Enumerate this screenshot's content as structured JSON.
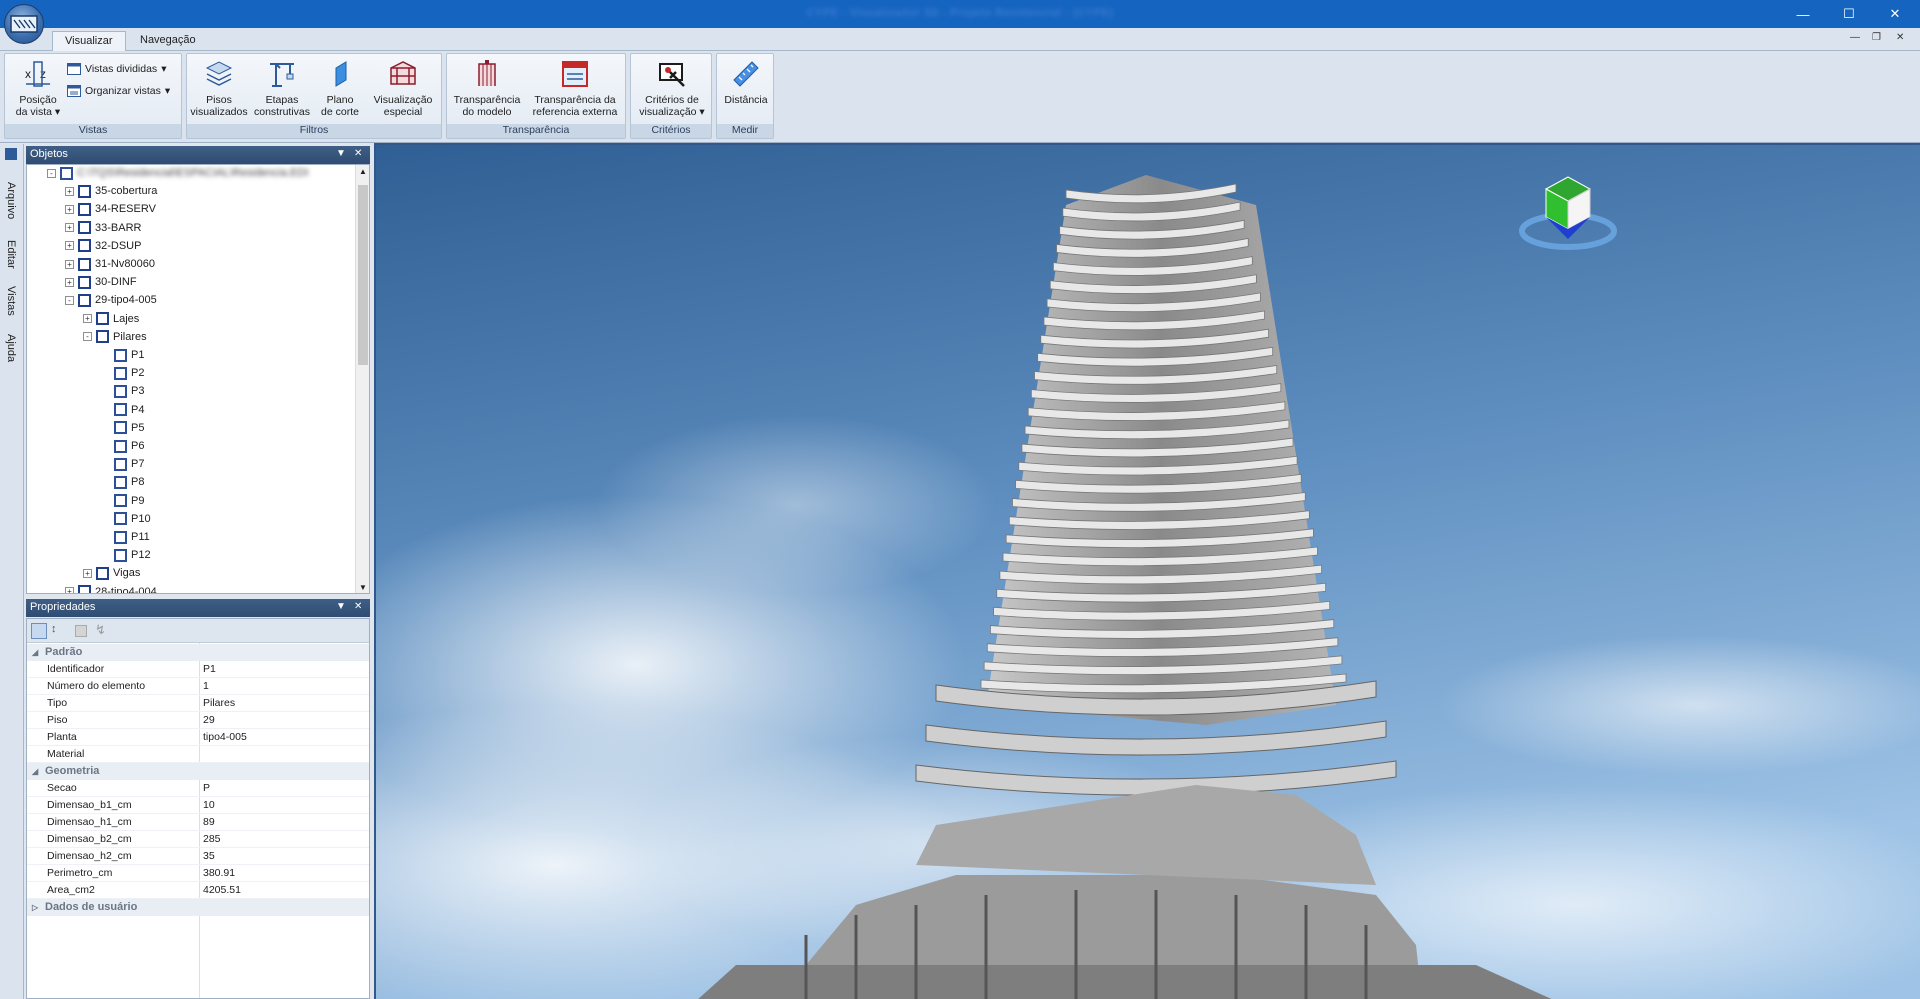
{
  "window": {
    "title": "CYPE - Visualizador 3D - Projeto Residencial - (CYPE)"
  },
  "ribbon_tabs": [
    "Visualizar",
    "Navegação"
  ],
  "groups": {
    "vistas": {
      "caption": "Vistas",
      "posicao_label_1": "Posição",
      "posicao_label_2": "da vista",
      "vistas_divididas": "Vistas divididas",
      "organizar_vistas": "Organizar vistas"
    },
    "filtros": {
      "caption": "Filtros",
      "pisos_1": "Pisos",
      "pisos_2": "visualizados",
      "etapas_1": "Etapas",
      "etapas_2": "construtivas",
      "plano_1": "Plano",
      "plano_2": "de corte",
      "visual_1": "Visualização",
      "visual_2": "especial"
    },
    "transparencia": {
      "caption": "Transparência",
      "modelo_1": "Transparência",
      "modelo_2": "do modelo",
      "ref_1": "Transparência da",
      "ref_2": "referencia externa"
    },
    "criterios": {
      "caption": "Critérios",
      "label_1": "Critérios de",
      "label_2": "visualização"
    },
    "medir": {
      "caption": "Medir",
      "label": "Distância"
    }
  },
  "side_tabs": [
    "Arquivo",
    "Editar",
    "Vistas",
    "Ajuda"
  ],
  "objects_panel": {
    "title": "Objetos",
    "root": "C:\\TQS\\Residencial\\ESPACIAL\\Residencia.EDI",
    "floors": [
      "35-cobertura",
      "34-RESERV",
      "33-BARR",
      "32-DSUP",
      "31-Nv80060",
      "30-DINF",
      "29-tipo4-005"
    ],
    "sub": [
      "Lajes",
      "Pilares"
    ],
    "pilares": [
      "P1",
      "P2",
      "P3",
      "P4",
      "P5",
      "P6",
      "P7",
      "P8",
      "P9",
      "P10",
      "P11",
      "P12"
    ],
    "vigas": "Vigas",
    "next_floor": "28-tipo4-004"
  },
  "properties_panel": {
    "title": "Propriedades",
    "cat_padrao": "Padrão",
    "padrao": [
      [
        "Identificador",
        "P1"
      ],
      [
        "Número do elemento",
        "1"
      ],
      [
        "Tipo",
        "Pilares"
      ],
      [
        "Piso",
        "29"
      ],
      [
        "Planta",
        "tipo4-005"
      ],
      [
        "Material",
        ""
      ]
    ],
    "cat_geometria": "Geometria",
    "geometria": [
      [
        "Secao",
        "P"
      ],
      [
        "Dimensao_b1_cm",
        "10"
      ],
      [
        "Dimensao_h1_cm",
        "89"
      ],
      [
        "Dimensao_b2_cm",
        "285"
      ],
      [
        "Dimensao_h2_cm",
        "35"
      ],
      [
        "Perimetro_cm",
        "380.91"
      ],
      [
        "Area_cm2",
        "4205.51"
      ]
    ],
    "cat_dados": "Dados de usuário"
  }
}
